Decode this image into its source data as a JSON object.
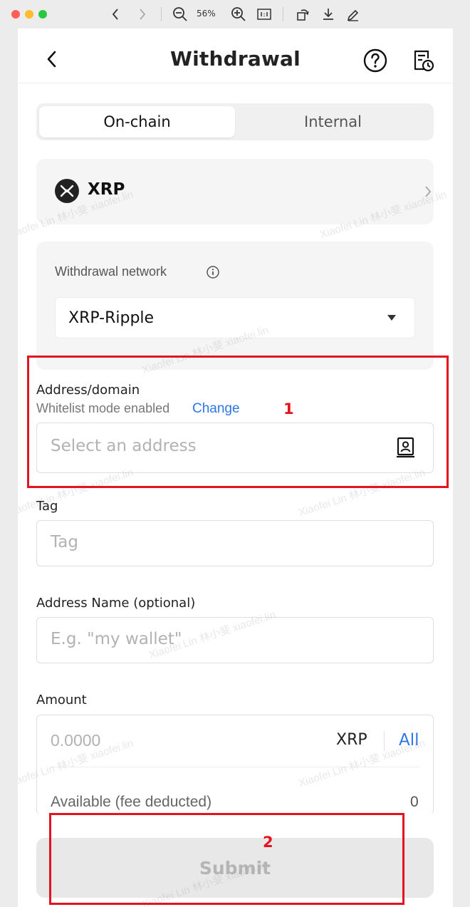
{
  "window": {
    "zoom": "56%",
    "icons": [
      "chevron-left-icon",
      "chevron-right-icon",
      "zoom-out-icon",
      "zoom-in-icon",
      "actual-size-icon",
      "rotate-icon",
      "download-icon",
      "markup-icon"
    ]
  },
  "header": {
    "title": "Withdrawal"
  },
  "tabs": [
    {
      "label": "On-chain",
      "active": true
    },
    {
      "label": "Internal",
      "active": false
    }
  ],
  "coin": {
    "name": "XRP"
  },
  "network": {
    "label": "Withdrawal network",
    "value": "XRP-Ripple"
  },
  "address": {
    "label": "Address/domain",
    "whitelist_text": "Whitelist mode enabled",
    "change_label": "Change",
    "placeholder": "Select an address"
  },
  "tag": {
    "label": "Tag",
    "placeholder": "Tag"
  },
  "address_name": {
    "label": "Address Name (optional)",
    "placeholder": "E.g. \"my wallet\""
  },
  "amount": {
    "label": "Amount",
    "placeholder": "0.0000",
    "unit": "XRP",
    "all_label": "All",
    "available_label": "Available (fee deducted)",
    "available_value": "0"
  },
  "submit_label": "Submit",
  "annotations": {
    "marker_1": "1",
    "marker_2": "2",
    "color": "#e3141f"
  },
  "watermark_text": "Xiaofei Lin 林小斐 xiaofei.lin",
  "colors": {
    "link": "#2d76e8",
    "disabled_button": "#e8e8e8"
  }
}
